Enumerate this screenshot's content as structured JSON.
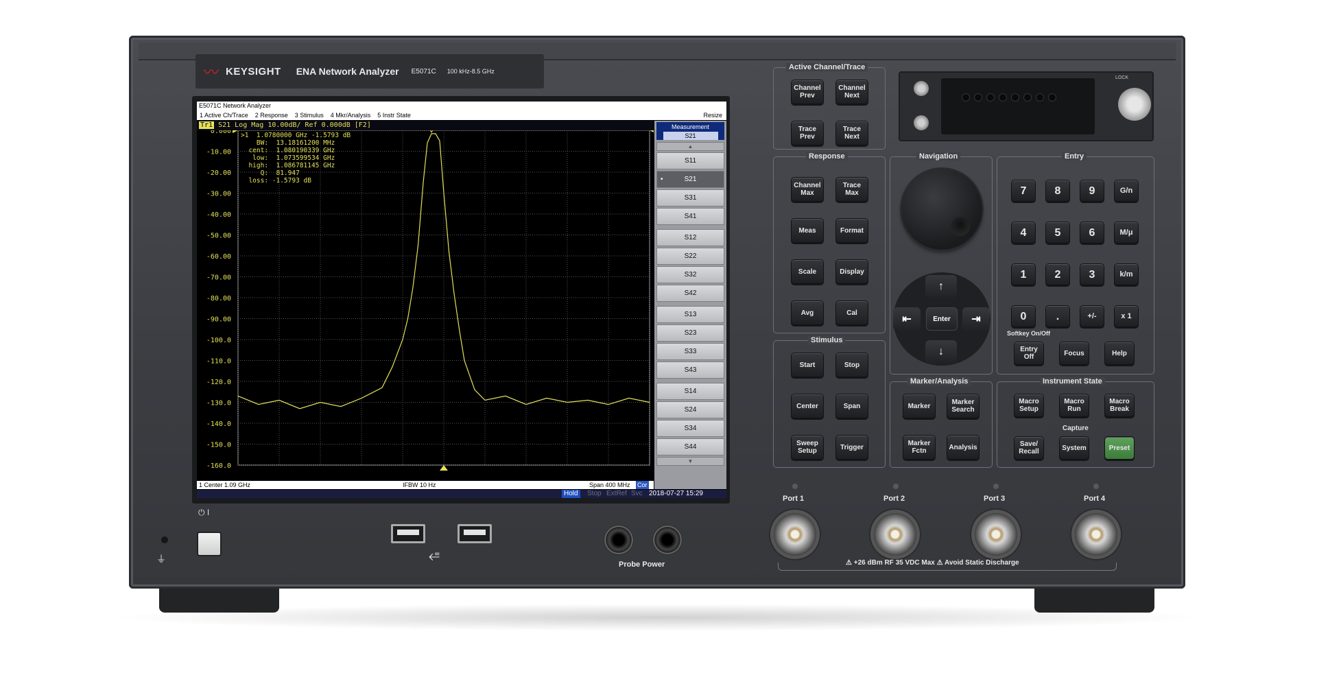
{
  "brand": {
    "logo_text": "KEYSIGHT",
    "product": "ENA Network Analyzer",
    "model": "E5071C",
    "range": "100 kHz-8.5 GHz"
  },
  "screen": {
    "window_title": "E5071C Network Analyzer",
    "menu": [
      "1 Active Ch/Trace",
      "2 Response",
      "3 Stimulus",
      "4 Mkr/Analysis",
      "5 Instr State"
    ],
    "menu_resize": "Resize",
    "trace_header": {
      "tag": "Tr1",
      "text": "S21  Log Mag 10.00dB/ Ref 0.000dB [F2]"
    },
    "marker_readout": {
      "line1": ">1  1.0780000 GHz -1.5793 dB",
      "bw": "    BW:  13.18161200 MHz",
      "cent": "  cent:  1.080190339 GHz",
      "low": "   low:  1.073599534 GHz",
      "high": "  high:  1.086781145 GHz",
      "q": "     Q:  81.947",
      "loss": "  loss: -1.5793 dB"
    },
    "status": {
      "center": "1  Center 1.09 GHz",
      "ifbw": "IFBW 10 Hz",
      "span": "Span 400 MHz",
      "cor": "Cor"
    },
    "bottom": {
      "hold": "Hold",
      "stop": "Stop",
      "extref": "ExtRef",
      "svc": "Svc",
      "datetime": "2018-07-27 15:29"
    },
    "softkeys": {
      "title": "Measurement",
      "current": "S21",
      "items": [
        "S11",
        "S21",
        "S31",
        "S41",
        "S12",
        "S22",
        "S32",
        "S42",
        "S13",
        "S23",
        "S33",
        "S43",
        "S14",
        "S24",
        "S34",
        "S44"
      ],
      "selected": "S21"
    }
  },
  "chart_data": {
    "type": "line",
    "title": "",
    "xlabel": "",
    "ylabel": "",
    "x_center_ghz": 1.09,
    "x_span_mhz": 400,
    "ylim": [
      -160,
      0
    ],
    "y_ticks": [
      "0.000",
      "-10.00",
      "-20.00",
      "-30.00",
      "-40.00",
      "-50.00",
      "-60.00",
      "-70.00",
      "-80.00",
      "-90.00",
      "-100.0",
      "-110.0",
      "-120.0",
      "-130.0",
      "-140.0",
      "-150.0",
      "-160.0"
    ],
    "series": [
      {
        "x_ghz": [
          0.89,
          0.91,
          0.93,
          0.95,
          0.97,
          0.99,
          1.01,
          1.03,
          1.04,
          1.05,
          1.055,
          1.06,
          1.065,
          1.07,
          1.074,
          1.078,
          1.082,
          1.086,
          1.09,
          1.095,
          1.1,
          1.105,
          1.11,
          1.12,
          1.13,
          1.15,
          1.17,
          1.19,
          1.21,
          1.23,
          1.25,
          1.27,
          1.29
        ],
        "y_db": [
          -127,
          -131,
          -129,
          -133,
          -130,
          -132,
          -128,
          -123,
          -113,
          -100,
          -90,
          -75,
          -55,
          -25,
          -6,
          -1.6,
          -1.6,
          -5,
          -30,
          -58,
          -78,
          -95,
          -110,
          -124,
          -129,
          -127,
          -131,
          -128,
          -130,
          -129,
          -131,
          -128,
          -130
        ]
      }
    ],
    "markers": [
      {
        "label": "1",
        "x_ghz": 1.078,
        "y_db": -1.5793
      }
    ],
    "grid": true,
    "trace_color": "#e6e05a"
  },
  "front_panel": {
    "sections": {
      "active": "Active Channel/Trace",
      "response": "Response",
      "navigation": "Navigation",
      "entry": "Entry",
      "stimulus": "Stimulus",
      "marker": "Marker/Analysis",
      "instr": "Instrument State",
      "softkey_onoff": "Softkey On/Off",
      "capture": "Capture"
    },
    "keys": {
      "ch_prev": "Channel Prev",
      "ch_next": "Channel Next",
      "tr_prev": "Trace Prev",
      "tr_next": "Trace Next",
      "ch_max": "Channel Max",
      "tr_max": "Trace Max",
      "meas": "Meas",
      "format": "Format",
      "scale": "Scale",
      "display": "Display",
      "avg": "Avg",
      "cal": "Cal",
      "start": "Start",
      "stop": "Stop",
      "center": "Center",
      "span": "Span",
      "sweep_setup": "Sweep Setup",
      "trigger": "Trigger",
      "marker": "Marker",
      "marker_search": "Marker Search",
      "marker_fctn": "Marker Fctn",
      "analysis": "Analysis",
      "macro_setup": "Macro Setup",
      "macro_run": "Macro Run",
      "macro_break": "Macro Break",
      "save_recall": "Save/ Recall",
      "system": "System",
      "preset": "Preset",
      "entry_off": "Entry Off",
      "focus": "Focus",
      "help": "Help",
      "enter": "Enter"
    },
    "entry_keys": [
      "7",
      "8",
      "9",
      "G/n",
      "4",
      "5",
      "6",
      "M/μ",
      "1",
      "2",
      "3",
      "k/m",
      "0",
      ".",
      "+/-",
      "x 1"
    ],
    "nav_arrows": {
      "up": "↑",
      "down": "↓",
      "left": "⇤",
      "right": "⇥"
    },
    "lock_label": "LOCK",
    "ports": [
      "Port 1",
      "Port 2",
      "Port 3",
      "Port 4"
    ],
    "port_warning": "⚠ +26 dBm RF  35 VDC Max   ⚠ Avoid Static Discharge",
    "probe_power": "Probe Power",
    "power_symbol": "⏻ I",
    "ground_symbol": "⏚",
    "usb_symbol": "⭀"
  }
}
